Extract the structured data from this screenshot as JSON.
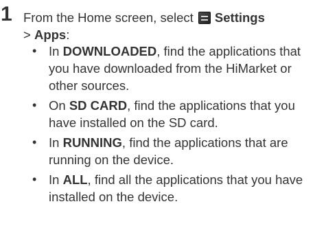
{
  "step": {
    "number": "1",
    "line1_prefix": "From the Home screen, select",
    "icon": "settings-icon",
    "settings_label": "Settings",
    "line2_sep": "> ",
    "apps_label": "Apps",
    "line2_colon": ":"
  },
  "bullets": [
    {
      "bullet": "•",
      "pre": "In ",
      "keyword": "DOWNLOADED",
      "post": ", find the applications that you have downloaded from the HiMarket or other sources."
    },
    {
      "bullet": "•",
      "pre": "On ",
      "keyword": "SD CARD",
      "post": ", find the applications that you have installed on the SD card."
    },
    {
      "bullet": "•",
      "pre": "In ",
      "keyword": "RUNNING",
      "post": ", find the applications that are running on the device."
    },
    {
      "bullet": "•",
      "pre": "In ",
      "keyword": "ALL",
      "post": ", find all the applications that you have installed on the device."
    }
  ]
}
